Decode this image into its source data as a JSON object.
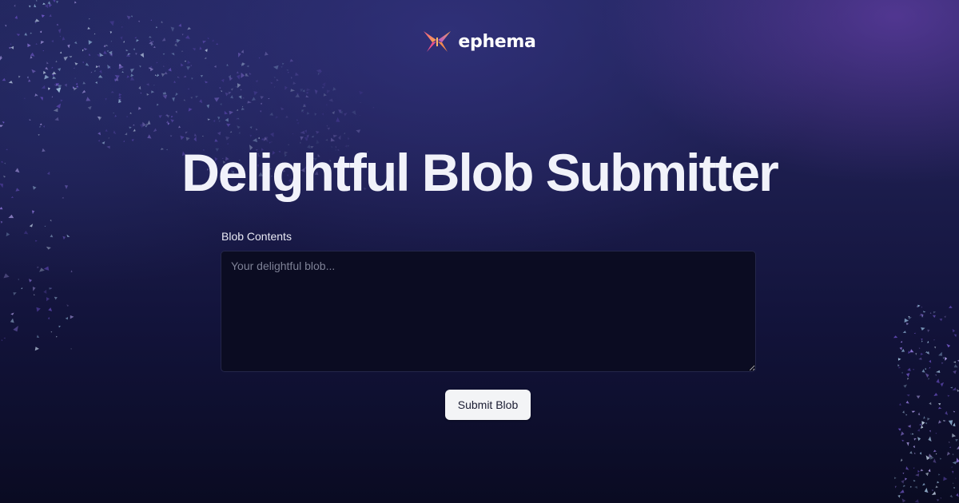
{
  "brand": {
    "name": "ephema",
    "logo_icon": "butterfly-icon",
    "logo_colors": [
      "#f35b88",
      "#f8a64f",
      "#b14ed8"
    ]
  },
  "page": {
    "title": "Delightful Blob Submitter"
  },
  "form": {
    "field_label": "Blob Contents",
    "field_placeholder": "Your delightful blob...",
    "field_value": "",
    "submit_label": "Submit Blob"
  },
  "colors": {
    "background_top": "#21245a",
    "background_bottom": "#0a0b22",
    "accent_glow": "#7846be",
    "button_bg": "#f3f4f6"
  }
}
